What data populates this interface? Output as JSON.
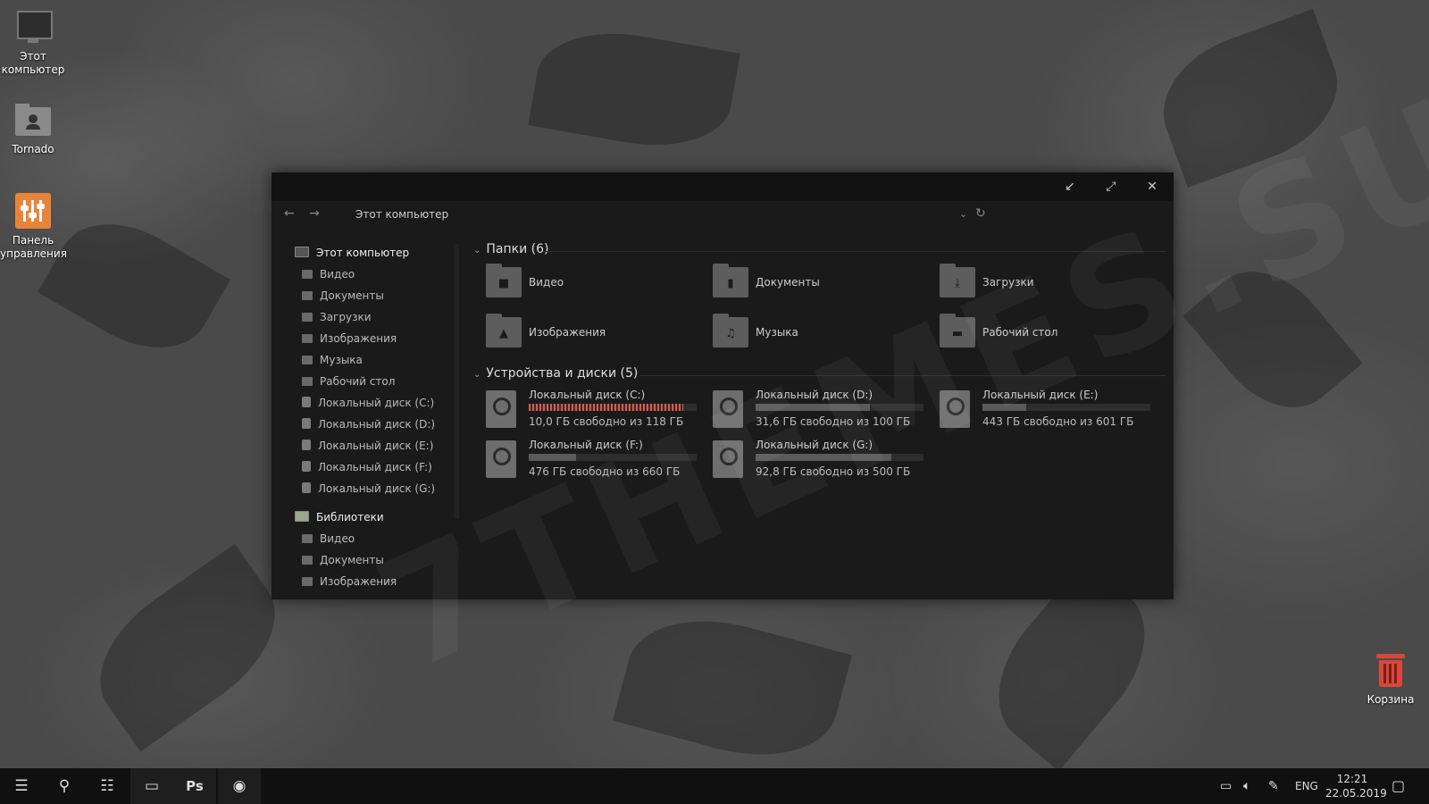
{
  "desktop": {
    "icons": [
      {
        "label": "Этот компьютер",
        "icon": "monitor-icon"
      },
      {
        "label": "Tornado",
        "icon": "user-folder-icon"
      },
      {
        "label": "Панель управления",
        "icon": "control-panel-icon"
      },
      {
        "label": "Корзина",
        "icon": "recycle-bin-icon"
      }
    ],
    "watermark": "7THEMES.SU"
  },
  "explorer": {
    "title_buttons": [
      "minimize",
      "maximize",
      "close"
    ],
    "breadcrumb": "Этот компьютер",
    "sidebar": {
      "this_pc": "Этот компьютер",
      "items": [
        "Видео",
        "Документы",
        "Загрузки",
        "Изображения",
        "Музыка",
        "Рабочий стол",
        "Локальный диск (C:)",
        "Локальный диск (D:)",
        "Локальный диск (E:)",
        "Локальный диск (F:)",
        "Локальный диск (G:)"
      ],
      "libraries": "Библиотеки",
      "library_items": [
        "Видео",
        "Документы",
        "Изображения"
      ]
    },
    "folders_header": "Папки (6)",
    "folders": [
      {
        "name": "Видео",
        "icon": "video-icon"
      },
      {
        "name": "Документы",
        "icon": "document-icon"
      },
      {
        "name": "Загрузки",
        "icon": "download-icon"
      },
      {
        "name": "Изображения",
        "icon": "image-icon"
      },
      {
        "name": "Музыка",
        "icon": "music-icon"
      },
      {
        "name": "Рабочий стол",
        "icon": "desktop-icon"
      }
    ],
    "drives_header": "Устройства и диски (5)",
    "drives": [
      {
        "name": "Локальный диск (C:)",
        "space": "10,0 ГБ свободно из 118 ГБ",
        "used_fraction": 0.92,
        "critical": true
      },
      {
        "name": "Локальный диск (D:)",
        "space": "31,6 ГБ свободно из 100 ГБ",
        "used_fraction": 0.68,
        "critical": false
      },
      {
        "name": "Локальный диск (E:)",
        "space": "443 ГБ свободно из 601 ГБ",
        "used_fraction": 0.26,
        "critical": false
      },
      {
        "name": "Локальный диск (F:)",
        "space": "476 ГБ свободно из 660 ГБ",
        "used_fraction": 0.28,
        "critical": false
      },
      {
        "name": "Локальный диск (G:)",
        "space": "92,8 ГБ свободно из 500 ГБ",
        "used_fraction": 0.81,
        "critical": false
      }
    ],
    "colors": {
      "critical": "#e05a46",
      "bar": "#5a5a5a"
    }
  },
  "taskbar": {
    "apps": [
      "menu-icon",
      "search-icon",
      "task-view-icon",
      "this-pc-icon",
      "Ps",
      "chrome-icon"
    ],
    "language": "ENG",
    "time": "12:21",
    "date": "22.05.2019"
  }
}
